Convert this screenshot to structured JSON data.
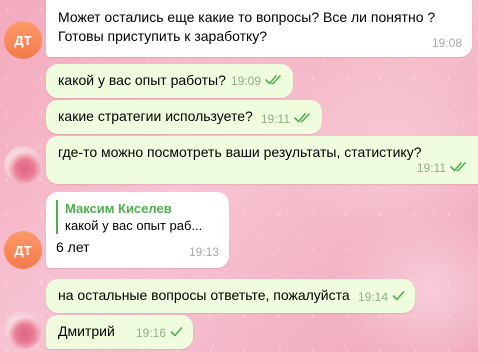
{
  "messages": [
    {
      "id": "m1",
      "text": "Может остались еще какие то вопросы? Все ли понятно ? Готовы приступить к заработку?",
      "time": "19:08",
      "direction": "in",
      "status": "none"
    },
    {
      "id": "m2",
      "text": "какой у вас опыт работы?",
      "time": "19:09",
      "direction": "out",
      "status": "read"
    },
    {
      "id": "m3",
      "text": "какие стратегии используете?",
      "time": "19:11",
      "direction": "out",
      "status": "read"
    },
    {
      "id": "m4",
      "text": "где-то можно посмотреть ваши результаты, статистику?",
      "time": "19:11",
      "direction": "out",
      "status": "read"
    },
    {
      "id": "m5",
      "reply_name": "Максим Киселев",
      "reply_text": "какой у вас опыт раб...",
      "text": "6 лет",
      "time": "19:13",
      "direction": "in",
      "status": "none"
    },
    {
      "id": "m6",
      "text": "на остальные вопросы ответьте, пожалуйста",
      "time": "19:14",
      "direction": "out",
      "status": "sent"
    },
    {
      "id": "m7",
      "text": "Дмитрий",
      "time": "19:16",
      "direction": "out",
      "status": "sent"
    }
  ],
  "avatars": {
    "contact_initials": "ДТ",
    "contact_color": "#f27a4a",
    "self_avatar": "photo-avatar"
  },
  "colors": {
    "outgoing_bubble": "#effdde",
    "incoming_bubble": "#ffffff",
    "checkmark": "#4fae4e",
    "reply_accent": "#4fae4e"
  }
}
